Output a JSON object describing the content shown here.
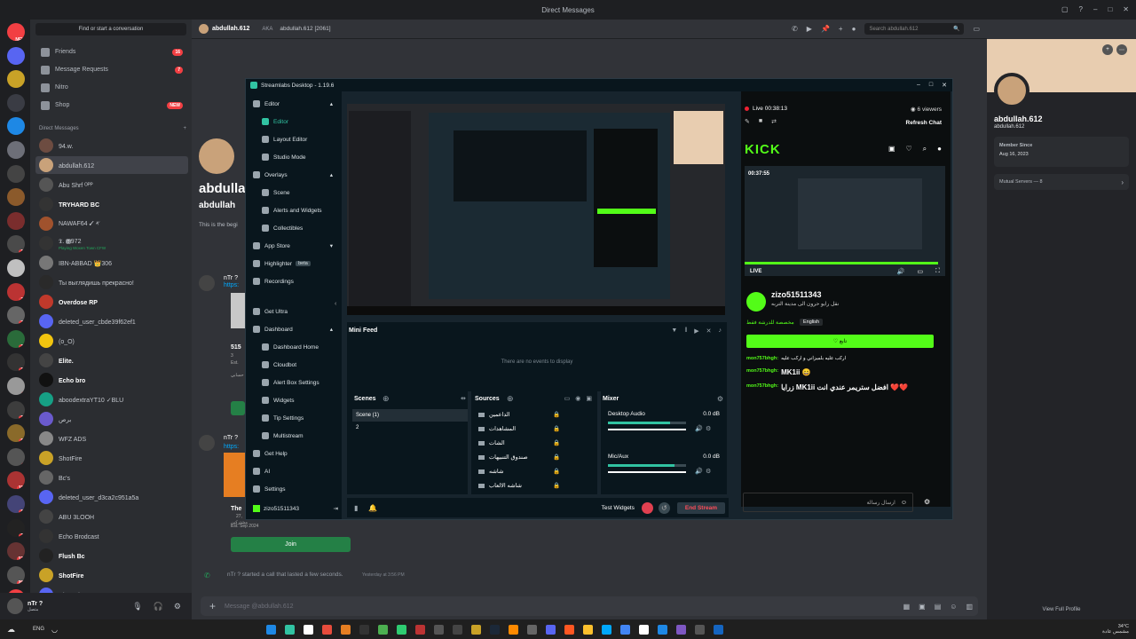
{
  "window": {
    "title": "Direct Messages"
  },
  "servers": [
    {
      "badge": "NEW",
      "color": "#f23f43"
    },
    {
      "badge": "",
      "color": "#5865f2"
    },
    {
      "badge": "",
      "color": "#c9a227"
    },
    {
      "badge": "",
      "color": "#3a3c44"
    },
    {
      "badge": "",
      "color": "#1e88e5"
    },
    {
      "badge": "",
      "color": "#6d6f78"
    },
    {
      "badge": "",
      "color": "#444"
    },
    {
      "badge": "5",
      "color": "#8b5a2b"
    },
    {
      "badge": "1",
      "color": "#7a2d2d"
    },
    {
      "badge": "12",
      "color": "#4a4a4a"
    },
    {
      "badge": "",
      "color": "#c0c0c0"
    },
    {
      "badge": "37",
      "color": "#b33"
    },
    {
      "badge": "79",
      "color": "#666"
    },
    {
      "badge": "20",
      "color": "#2a6b3a"
    },
    {
      "badge": "13",
      "color": "#333"
    },
    {
      "badge": "1",
      "color": "#999"
    },
    {
      "badge": "27",
      "color": "#3d3d3d"
    },
    {
      "badge": "96",
      "color": "#8a6a2a"
    },
    {
      "badge": "5",
      "color": "#555"
    },
    {
      "badge": "112",
      "color": "#a33"
    },
    {
      "badge": "86",
      "color": "#447"
    },
    {
      "badge": "32",
      "color": "#222"
    },
    {
      "badge": "126",
      "color": "#633"
    },
    {
      "badge": "290",
      "color": "#555"
    },
    {
      "badge": "NEW",
      "color": "#f23f43"
    }
  ],
  "dm_panel": {
    "find": "Find or start a conversation",
    "nav": [
      {
        "label": "Friends",
        "badge": "16"
      },
      {
        "label": "Message Requests",
        "badge": "7"
      },
      {
        "label": "Nitro",
        "badge": ""
      },
      {
        "label": "Shop",
        "badge": "NEW"
      }
    ],
    "header": "Direct Messages",
    "add": "+",
    "dms": [
      {
        "name": "94.w.",
        "sub": "",
        "color": "#6d4c41"
      },
      {
        "name": "abdullah.612",
        "sub": "",
        "color": "#c9a27a",
        "selected": true
      },
      {
        "name": "Abu Shrf ᴼᴾᴾ",
        "sub": "",
        "color": "#555"
      },
      {
        "name": "TRYHARD BC",
        "sub": "",
        "color": "#333",
        "bold": true
      },
      {
        "name": "NAWAF𐤀 ✓ 64",
        "sub": "",
        "color": "#a0522d"
      },
      {
        "name": "𝕿. 🅼972",
        "sub": "Playing Woxen Town CFW",
        "color": "#333"
      },
      {
        "name": "IBN-ABBAD 👑306",
        "sub": "",
        "color": "#777"
      },
      {
        "name": "Ты выглядишь прекрасно!",
        "sub": "",
        "color": "#2a2a2a"
      },
      {
        "name": "Overdose RP",
        "sub": "",
        "color": "#c0392b",
        "bold": true
      },
      {
        "name": "deleted_user_cbde39f62ef1",
        "sub": "",
        "color": "#5865f2"
      },
      {
        "name": "(o_O)",
        "sub": "",
        "color": "#f1c40f"
      },
      {
        "name": "Elite.",
        "sub": "",
        "color": "#444",
        "bold": true
      },
      {
        "name": "Echo bro",
        "sub": "",
        "color": "#111",
        "bold": true
      },
      {
        "name": "aboodextraYT10 ✓BLU",
        "sub": "",
        "color": "#16a085"
      },
      {
        "name": "برص",
        "sub": "",
        "color": "#6a5acd"
      },
      {
        "name": "WFZ ADS",
        "sub": "",
        "color": "#888"
      },
      {
        "name": "ShotFire",
        "sub": "",
        "color": "#c9a227"
      },
      {
        "name": "Bc's",
        "sub": "",
        "color": "#666"
      },
      {
        "name": "deleted_user_d3ca2c951a5a",
        "sub": "",
        "color": "#5865f2"
      },
      {
        "name": "ABU 3LOOH",
        "sub": "",
        "color": "#444"
      },
      {
        "name": "Echo Brodcast",
        "sub": "",
        "color": "#333"
      },
      {
        "name": "Flush Bc",
        "sub": "",
        "color": "#222",
        "bold": true
      },
      {
        "name": "ShotFire",
        "sub": "",
        "color": "#c9a227",
        "bold": true
      },
      {
        "name": "Discord OFFICIAL",
        "sub": "",
        "color": "#5865f2"
      }
    ]
  },
  "userbar": {
    "name": "nTr ?",
    "status": "ﻣﺘﺼﻞ"
  },
  "chat": {
    "name": "abdullah.612",
    "aka_label": "AKA",
    "aka": "abdullah.612 [2061]",
    "intro_name": "abdullah",
    "intro_tag": "abdullah",
    "intro_text": "This is the begi",
    "msg_author1": "nTr ?",
    "msg_link1": "https:",
    "card1_num": "515",
    "card1_members": "3",
    "card1_est": "Est.",
    "card1_arabic": "حسابي",
    "msg_author2": "nTr ?",
    "msg_link2": "https:",
    "card2_title": "The",
    "card2_members": "27,",
    "card2_sub": "مشتركين",
    "card2_est": "Est. Sep 2024",
    "join": "Join",
    "call_line": "nTr ? started a call that lasted a few seconds.",
    "call_time": "Yesterday at 3:56 PM",
    "input_placeholder": "Message @abdullah.612"
  },
  "search_placeholder": "Search abdullah.612",
  "profile": {
    "name": "abdullah.612",
    "tag": "abdullah.612",
    "member_since_label": "Member Since",
    "member_since": "Aug 16, 2023",
    "mutual": "Mutual Servers — 8",
    "view_full": "View Full Profile"
  },
  "streamlabs": {
    "title": "Streamlabs Desktop - 1.19.6",
    "nav": [
      {
        "label": "Editor",
        "sub": false,
        "active": false,
        "chev": "▴"
      },
      {
        "label": "Editor",
        "sub": true,
        "active": true
      },
      {
        "label": "Layout Editor",
        "sub": true
      },
      {
        "label": "Studio Mode",
        "sub": true
      },
      {
        "label": "Overlays",
        "sub": false,
        "chev": "▴"
      },
      {
        "label": "Scene",
        "sub": true
      },
      {
        "label": "Alerts and Widgets",
        "sub": true
      },
      {
        "label": "Collectibles",
        "sub": true
      },
      {
        "label": "App Store",
        "sub": false,
        "chev": "▾"
      },
      {
        "label": "Highlighter",
        "sub": false,
        "tag": "beta"
      },
      {
        "label": "Recordings",
        "sub": false
      },
      {
        "label": "Get Ultra",
        "sub": false
      },
      {
        "label": "Dashboard",
        "sub": false,
        "chev": "▴"
      },
      {
        "label": "Dashboard Home",
        "sub": true
      },
      {
        "label": "Cloudbot",
        "sub": true
      },
      {
        "label": "Alert Box Settings",
        "sub": true
      },
      {
        "label": "Widgets",
        "sub": true
      },
      {
        "label": "Tip Settings",
        "sub": true
      },
      {
        "label": "Multistream",
        "sub": true
      },
      {
        "label": "Get Help",
        "sub": false
      },
      {
        "label": "AI",
        "sub": false
      },
      {
        "label": "Settings",
        "sub": false
      }
    ],
    "account": "zizo51511343",
    "mini_feed": "Mini Feed",
    "no_events": "There are no events to display",
    "scenes_label": "Scenes",
    "scenes": [
      "Scene (1)",
      "2"
    ],
    "sources_label": "Sources",
    "sources": [
      "الداعمين",
      "المشاهدات",
      "الشات",
      "صندوق التنبيهات",
      "شاشه",
      "شاشه الالعاب"
    ],
    "mixer_label": "Mixer",
    "mixer": [
      {
        "name": "Desktop Audio",
        "db": "0.0 dB",
        "level": 0.8
      },
      {
        "name": "Mic/Aux",
        "db": "0.0 dB",
        "level": 0.85
      }
    ],
    "test_widgets": "Test Widgets",
    "end_stream": "End Stream",
    "live_time": "Live 00:38:13",
    "viewers": "6 viewers",
    "refresh_chat": "Refresh Chat",
    "kick_logo": "KICK",
    "player_time": "00:37:55",
    "live_label": "LIVE",
    "channel": "zizo51511343",
    "channel_sub": "نقل رايو حرون الى مدينة التربه",
    "category": "مخصصة للدرشة فقط",
    "language": "English",
    "follow": "♡ تابع",
    "chat_lines": [
      {
        "user": "mon757bhgh:",
        "text": "اركب عليه بلميزاني و اركب عليه"
      },
      {
        "user": "mon757bhgh:",
        "text": "MK1ii 😄"
      },
      {
        "user": "mon757bhgh:",
        "text": "زرايا MK1ii افضل ستريمر عندي انت ❤️❤️"
      }
    ],
    "chat_input": "ارسال رسالة"
  },
  "taskbar": {
    "lang": "ENG",
    "temp": "34°C",
    "weather": "مشمس عادة",
    "time": "٥:٤٢ م",
    "date": "٢٠٢٤/١٠/١٠"
  }
}
